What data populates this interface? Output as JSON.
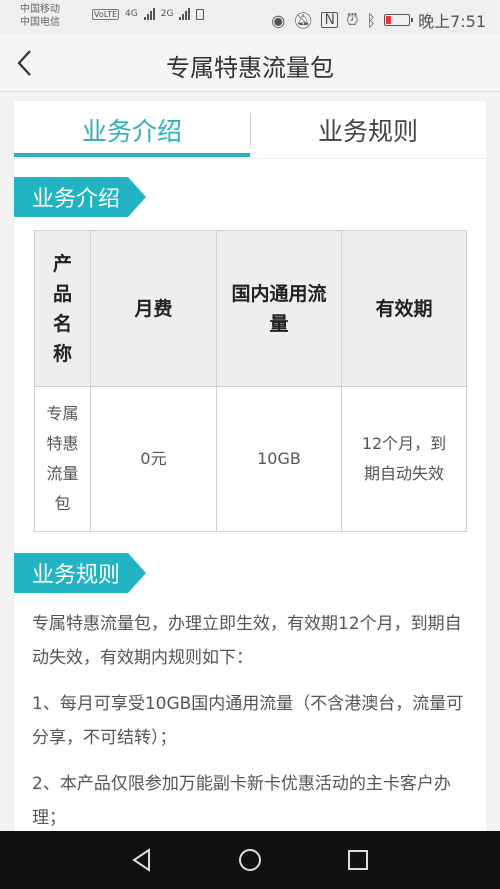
{
  "status_bar": {
    "carrier1": "中国移动",
    "carrier1_tag": "VoLTE",
    "carrier2": "中国电信",
    "net1": "4G",
    "net2": "2G",
    "time": "晚上7:51"
  },
  "header": {
    "title": "专属特惠流量包"
  },
  "tabs": [
    {
      "label": "业务介绍",
      "active": true
    },
    {
      "label": "业务规则",
      "active": false
    }
  ],
  "intro": {
    "heading": "业务介绍",
    "table": {
      "headers": [
        "产品名称",
        "月费",
        "国内通用流量",
        "有效期"
      ],
      "row": [
        "专属特惠流量包",
        "0元",
        "10GB",
        "12个月，到期自动失效"
      ]
    }
  },
  "rules": {
    "heading": "业务规则",
    "paragraphs": [
      "专属特惠流量包，办理立即生效，有效期12个月，到期自动失效，有效期内规则如下：",
      "1、每月可享受10GB国内通用流量（不含港澳台，流量可分享，不可结转）；",
      "2、本产品仅限参加万能副卡新卡优惠活动的主卡客户办理；"
    ]
  },
  "colors": {
    "accent": "#2ab0bd",
    "section_tag": "#22b4c3"
  }
}
